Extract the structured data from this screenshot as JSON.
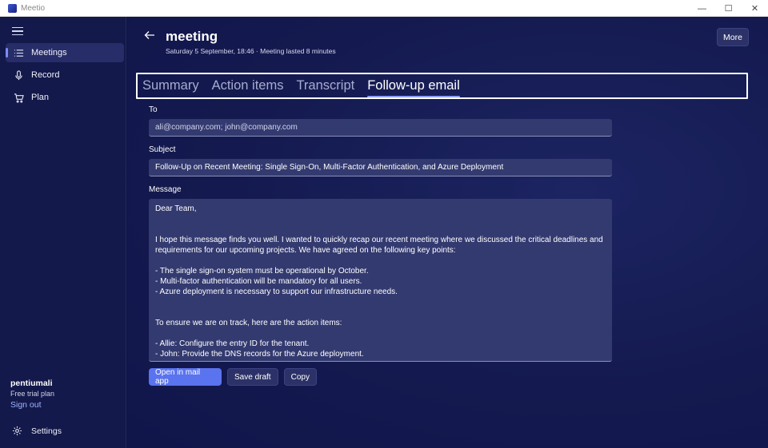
{
  "window": {
    "app_name": "Meetio",
    "controls": [
      "—",
      "☐",
      "✕"
    ]
  },
  "sidebar": {
    "items": [
      {
        "label": "Meetings",
        "icon": "list-icon",
        "active": true
      },
      {
        "label": "Record",
        "icon": "microphone-icon",
        "active": false
      },
      {
        "label": "Plan",
        "icon": "cart-icon",
        "active": false
      }
    ],
    "user": {
      "name": "pentiumali",
      "plan": "Free trial plan"
    },
    "sign_out_label": "Sign out",
    "settings_label": "Settings"
  },
  "header": {
    "title": "meeting",
    "subtitle": "Saturday 5 September, 18:46 · Meeting lasted 8 minutes",
    "more_label": "More"
  },
  "tabs": [
    {
      "label": "Summary",
      "active": false
    },
    {
      "label": "Action items",
      "active": false
    },
    {
      "label": "Transcript",
      "active": false
    },
    {
      "label": "Follow-up email",
      "active": true
    }
  ],
  "email": {
    "to_label": "To",
    "to_value": "ali@company.com; john@company.com",
    "subject_label": "Subject",
    "subject_value": "Follow-Up on Recent Meeting: Single Sign-On, Multi-Factor Authentication, and Azure Deployment",
    "message_label": "Message",
    "message_lines": [
      "Dear Team,",
      "",
      "",
      "I hope this message finds you well. I wanted to quickly recap our recent meeting where we discussed the critical deadlines and",
      "requirements for our upcoming projects. We have agreed on the following key points:",
      "",
      "- The single sign-on system must be operational by October.",
      "- Multi-factor authentication will be mandatory for all users.",
      "- Azure deployment is necessary to support our infrastructure needs.",
      "",
      "",
      "To ensure we are on track, here are the action items:",
      "",
      "- Allie: Configure the entry ID for the tenant.",
      "- John: Provide the DNS records for the Azure deployment."
    ]
  },
  "actions": {
    "open_mail_label": "Open in mail app",
    "save_draft_label": "Save draft",
    "copy_label": "Copy"
  },
  "colors": {
    "accent": "#5a73ee",
    "background": "#10164a",
    "sidebar": "#13194a"
  }
}
